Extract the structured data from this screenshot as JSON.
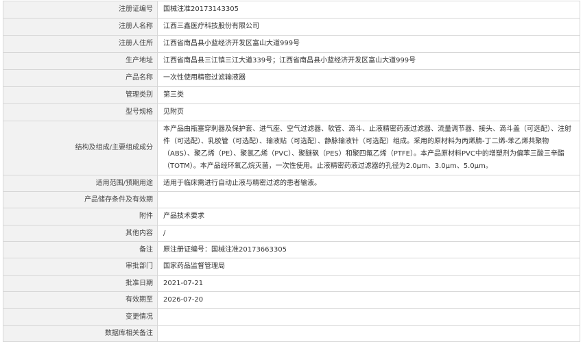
{
  "record": {
    "rows": [
      {
        "label": "注册证编号",
        "value": "国械注准20173143305"
      },
      {
        "label": "注册人名称",
        "value": "江西三鑫医疗科技股份有限公司"
      },
      {
        "label": "注册人住所",
        "value": "江西省南昌县小蓝经济开发区富山大道999号"
      },
      {
        "label": "生产地址",
        "value": "江西省南昌县三江镇三江大道339号；江西省南昌县小蓝经济开发区富山大道999号"
      },
      {
        "label": "产品名称",
        "value": "一次性使用精密过滤输液器"
      },
      {
        "label": "管理类别",
        "value": "第三类"
      },
      {
        "label": "型号规格",
        "value": "见附页"
      },
      {
        "label": "结构及组成/主要组成成分",
        "value": "本产品由瓶塞穿刺器及保护套、进气座、空气过滤器、软管、滴斗、止液精密药液过滤器、流量调节器、接头、滴斗盖（可选配）、注射件（可选配）、乳胶管（可选配）、输液贴（可选配）、静脉输液针（可选配）组成。采用的原材料为丙烯腈-丁二烯-苯乙烯共聚物（ABS）、聚乙烯（PE）、聚氯乙烯（PVC）、聚醚砜（PES）和聚四氟乙烯（PTFE）。本产品原材料PVC中的增塑剂为偏苯三酸三辛酯（TOTM）。本产品经环氧乙烷灭菌，一次性使用。止液精密药液过滤器的孔径为2.0μm、3.0μm、5.0μm。"
      },
      {
        "label": "适用范围/预期用途",
        "value": "适用于临床需进行自动止液与精密过滤的患者输液。"
      },
      {
        "label": "产品储存条件及有效期",
        "value": ""
      },
      {
        "label": "附件",
        "value": "产品技术要求"
      },
      {
        "label": "其他内容",
        "value": "/"
      },
      {
        "label": "备注",
        "value": "原注册证编号：国械注准20173663305"
      },
      {
        "label": "审批部门",
        "value": "国家药品监督管理局"
      },
      {
        "label": "批准日期",
        "value": "2021-07-21"
      },
      {
        "label": "有效期至",
        "value": "2026-07-20"
      },
      {
        "label": "变更情况",
        "value": ""
      },
      {
        "label": "数据库相关备注",
        "value": ""
      }
    ]
  }
}
